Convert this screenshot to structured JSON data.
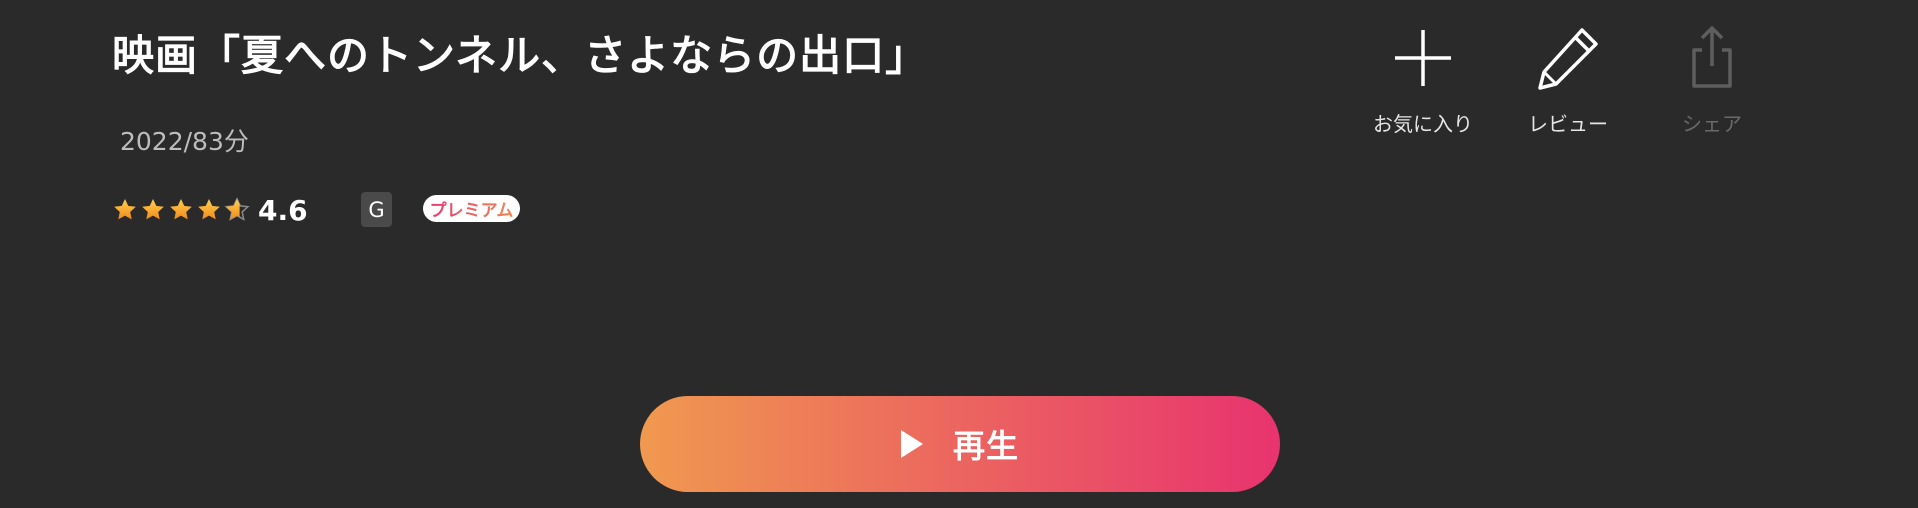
{
  "title": "映画「夏へのトンネル、さよならの出口」",
  "meta": {
    "year_duration": "2022/83分"
  },
  "rating": {
    "value": "4.6",
    "stars": [
      {
        "fill": 1
      },
      {
        "fill": 1
      },
      {
        "fill": 1
      },
      {
        "fill": 1
      },
      {
        "fill": 0.6
      }
    ],
    "star_color": "#f5a623"
  },
  "badges": {
    "age": "G",
    "premium": "プレミアム"
  },
  "actions": {
    "favorite": {
      "label": "お気に入り",
      "icon": "plus-icon"
    },
    "review": {
      "label": "レビュー",
      "icon": "pencil-icon"
    },
    "share": {
      "label": "シェア",
      "icon": "share-icon"
    }
  },
  "play": {
    "label": "再生",
    "icon": "play-icon"
  },
  "colors": {
    "background": "#2a2a2a",
    "accent_start": "#f0994f",
    "accent_end": "#e8336f"
  }
}
